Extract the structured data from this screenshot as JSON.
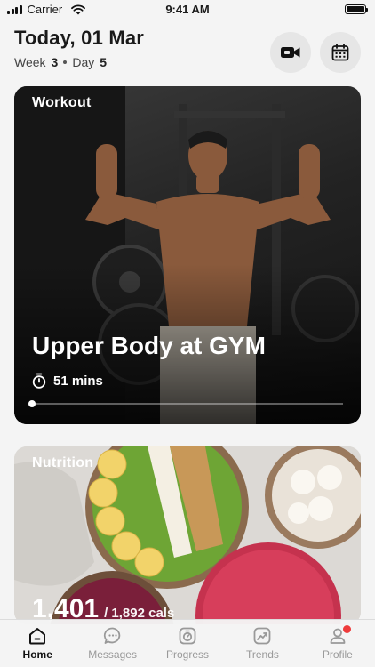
{
  "status_bar": {
    "carrier": "Carrier",
    "time": "9:41 AM"
  },
  "header": {
    "title": "Today, 01 Mar",
    "week_label": "Week",
    "week_value": "3",
    "day_label": "Day",
    "day_value": "5",
    "video_icon": "video-camera-icon",
    "calendar_icon": "calendar-icon"
  },
  "workout": {
    "tag": "Workout",
    "title": "Upper Body at GYM",
    "duration": "51 mins",
    "progress": 0.0
  },
  "nutrition": {
    "tag": "Nutrition",
    "calories_consumed": "1,401",
    "calories_total": "/ 1,892 cals"
  },
  "tabs": [
    {
      "label": "Home",
      "icon": "home-icon",
      "active": true
    },
    {
      "label": "Messages",
      "icon": "chat-icon",
      "active": false
    },
    {
      "label": "Progress",
      "icon": "progress-icon",
      "active": false
    },
    {
      "label": "Trends",
      "icon": "trends-icon",
      "active": false
    },
    {
      "label": "Profile",
      "icon": "profile-icon",
      "active": false,
      "badge": true
    }
  ],
  "colors": {
    "accent": "#111111",
    "badge": "#ee3b3b",
    "inactive_tab": "#999999"
  }
}
